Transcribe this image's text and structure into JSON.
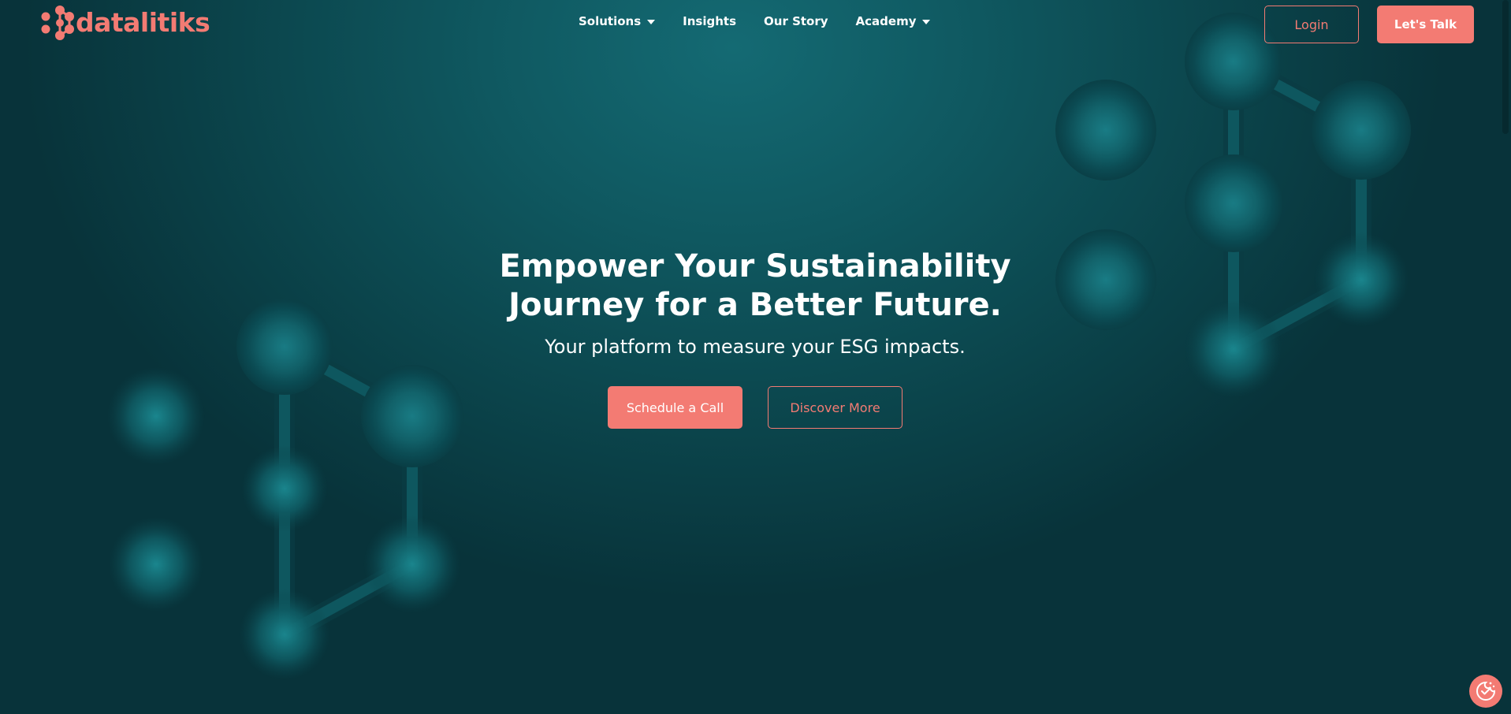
{
  "brand": {
    "name": "datalitiks",
    "accent_color": "#f37b73",
    "background_color": "#0b444b"
  },
  "nav": {
    "items": [
      {
        "label": "Solutions",
        "has_dropdown": true
      },
      {
        "label": "Insights",
        "has_dropdown": false
      },
      {
        "label": "Our Story",
        "has_dropdown": false
      },
      {
        "label": "Academy",
        "has_dropdown": true
      }
    ],
    "login_label": "Login",
    "cta_label": "Let's Talk"
  },
  "hero": {
    "title_line1": "Empower Your Sustainability",
    "title_line2": "Journey for a Better Future.",
    "subtitle": "Your platform to measure your ESG impacts.",
    "primary_button": "Schedule a Call",
    "secondary_button": "Discover More"
  },
  "icons": {
    "cookie_settings": "cookie-consent-icon",
    "dropdown": "caret-down-icon"
  }
}
